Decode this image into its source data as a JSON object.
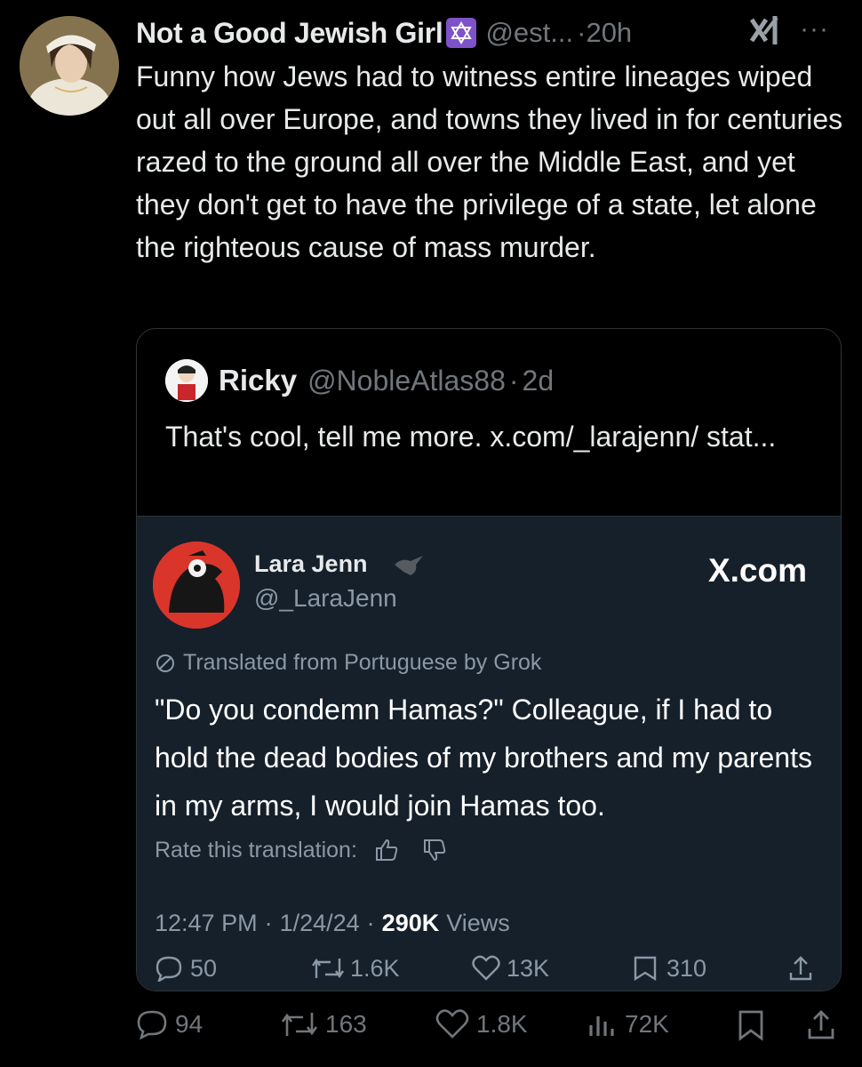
{
  "tweet": {
    "author_name": "Not a Good Jewish Girl",
    "author_handle": "@est...",
    "dot": "·",
    "time": "20h",
    "text": "Funny how Jews had to witness entire lineages wiped out all over Europe, and towns they lived in for centuries razed to the ground all over the Middle East, and yet they don't get to have the privilege of a state, let alone the righteous cause of mass murder.",
    "more_label": "···"
  },
  "quote": {
    "author_name": "Ricky",
    "author_handle": "@NobleAtlas88",
    "dot": "·",
    "time": "2d",
    "text": "That's cool, tell me more. x.com/_larajenn/ stat..."
  },
  "embed": {
    "author_name": "Lara Jenn",
    "author_handle": "@_LaraJenn",
    "site_label": "X.com",
    "translated_label": "Translated from Portuguese by Grok",
    "text": "\"Do you condemn Hamas?\" Colleague, if I had to hold the dead bodies of my brothers and my parents in my arms, I would join Hamas too.",
    "rate_label": "Rate this translation:",
    "time": "12:47 PM",
    "date": "1/24/24",
    "sep": "·",
    "views_count": "290K",
    "views_label": "Views",
    "actions": {
      "replies": "50",
      "reposts": "1.6K",
      "likes": "13K",
      "bookmarks": "310"
    }
  },
  "actions": {
    "replies": "94",
    "reposts": "163",
    "likes": "1.8K",
    "views": "72K"
  },
  "colors": {
    "background": "#000000",
    "text": "#e7e9ea",
    "muted": "#71767b",
    "embed_bg": "#15202b",
    "star_badge": "#7e52c9"
  },
  "icons": [
    "star-of-david-icon",
    "grok-icon",
    "more-icon",
    "bird-icon",
    "reply-icon",
    "repost-icon",
    "like-icon",
    "views-icon",
    "bookmark-icon",
    "share-icon",
    "thumbs-up-icon",
    "thumbs-down-icon",
    "translate-icon"
  ]
}
